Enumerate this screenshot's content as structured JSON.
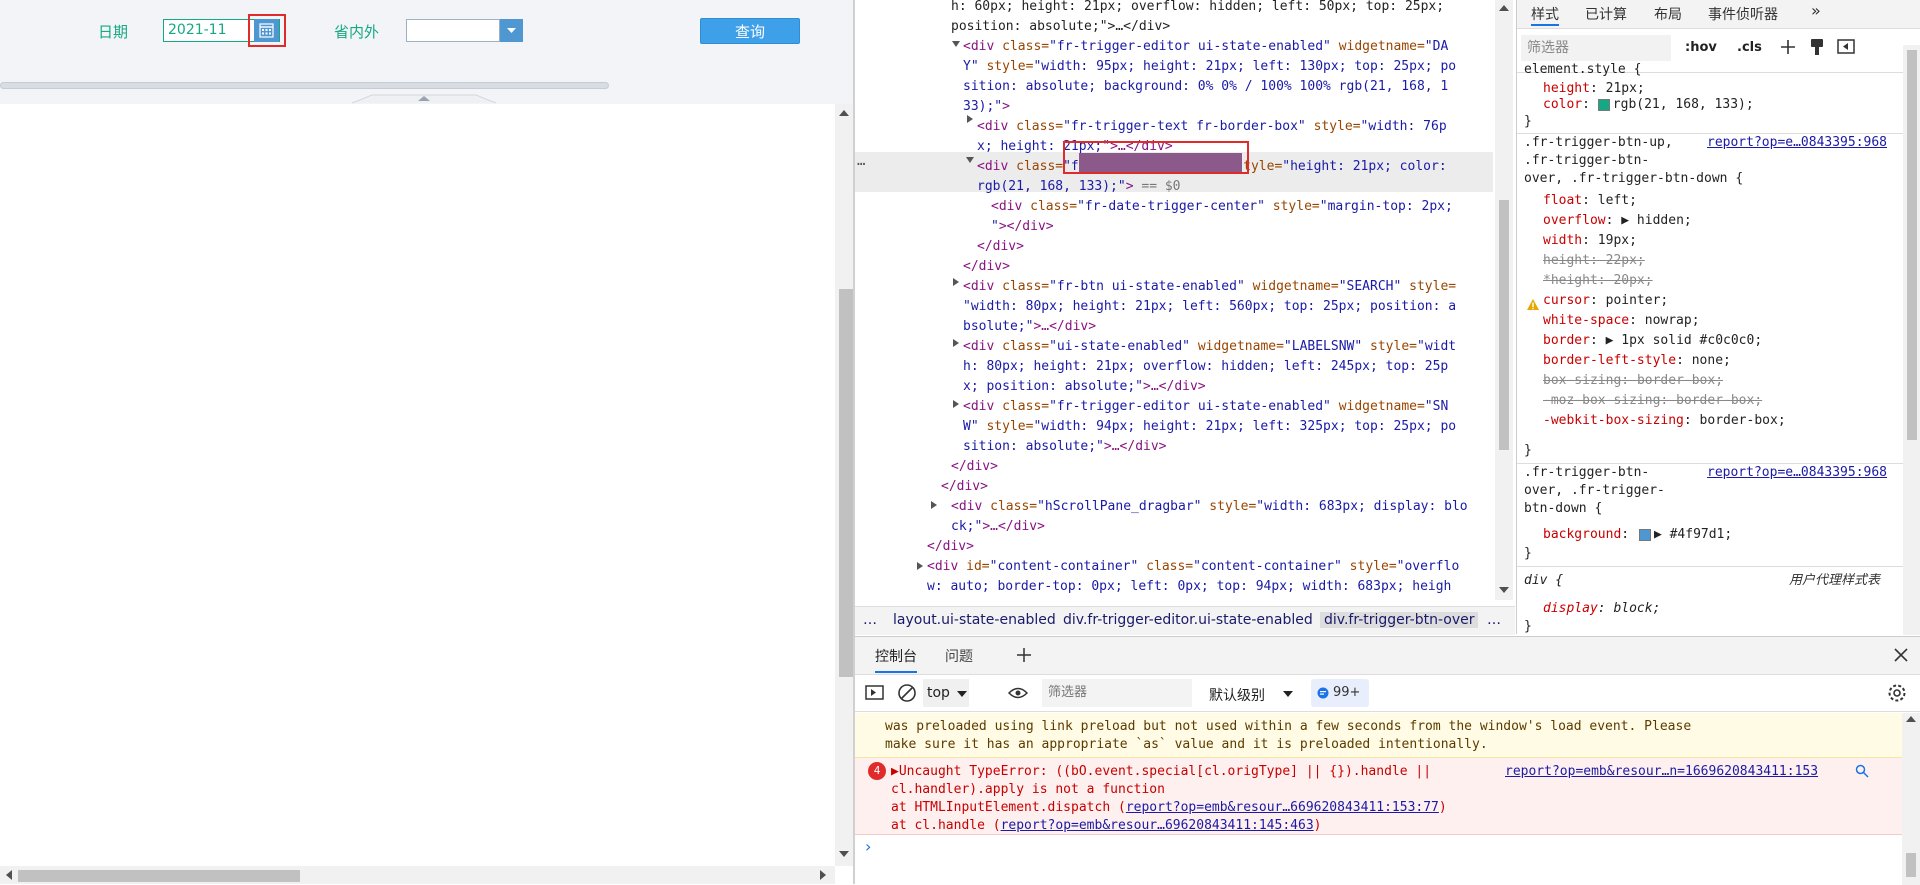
{
  "left": {
    "date_label": "日期",
    "date_value": "2021-11",
    "snw_label": "省内外",
    "snw_value": "",
    "search_label": "查询"
  },
  "elements": {
    "lines": [
      {
        "text_parts": [
          {
            "c": "txt",
            "t": "h: 60px; height: 21px; overflow: hidden; left: 50px; top: 25px;"
          }
        ]
      },
      {
        "text_parts": [
          {
            "c": "txt",
            "t": "position: absolute;\">…</div>"
          }
        ]
      },
      {
        "text_parts": [
          {
            "c": "tag",
            "t": "<div "
          },
          {
            "c": "attr",
            "t": "class="
          },
          {
            "c": "val",
            "t": "\"fr-trigger-editor ui-state-enabled\""
          },
          {
            "c": "attr",
            "t": " widgetname="
          },
          {
            "c": "val",
            "t": "\"DA"
          }
        ]
      },
      {
        "text_parts": [
          {
            "c": "val",
            "t": "Y\""
          },
          {
            "c": "attr",
            "t": " style="
          },
          {
            "c": "val",
            "t": "\"width: 95px; height: 21px; left: 130px; top: 25px; po"
          }
        ]
      },
      {
        "text_parts": [
          {
            "c": "val",
            "t": "sition: absolute; background:  0% 0% / 100% 100% rgb(21, 168, 1"
          }
        ]
      },
      {
        "text_parts": [
          {
            "c": "val",
            "t": "33);\""
          },
          {
            "c": "tag",
            "t": ">"
          }
        ]
      },
      {
        "text_parts": [
          {
            "c": "tag",
            "t": "<div "
          },
          {
            "c": "attr",
            "t": "class="
          },
          {
            "c": "val",
            "t": "\"fr-trigger-text fr-border-box\""
          },
          {
            "c": "attr",
            "t": " style="
          },
          {
            "c": "val",
            "t": "\"width: 76p"
          }
        ]
      },
      {
        "text_parts": [
          {
            "c": "val",
            "t": "x; height: 21px;\""
          },
          {
            "c": "tag",
            "t": ">…</div>"
          }
        ]
      },
      {
        "text_parts": [
          {
            "c": "tag",
            "t": "<div "
          },
          {
            "c": "attr",
            "t": "class="
          },
          {
            "c": "val",
            "t": "\"fr-trigger-btn-over\""
          },
          {
            "c": "attr",
            "t": " style="
          },
          {
            "c": "val",
            "t": "\"height: 21px; color:"
          }
        ]
      },
      {
        "text_parts": [
          {
            "c": "val",
            "t": "rgb(21, 168, 133);\""
          },
          {
            "c": "tag",
            "t": ">"
          },
          {
            "c": "cmt",
            "t": " == $0"
          }
        ]
      },
      {
        "text_parts": [
          {
            "c": "tag",
            "t": "<div "
          },
          {
            "c": "attr",
            "t": "class="
          },
          {
            "c": "val",
            "t": "\"fr-date-trigger-center\""
          },
          {
            "c": "attr",
            "t": " style="
          },
          {
            "c": "val",
            "t": "\"margin-top: 2px;"
          }
        ]
      },
      {
        "text_parts": [
          {
            "c": "val",
            "t": "\""
          },
          {
            "c": "tag",
            "t": "></div>"
          }
        ]
      },
      {
        "text_parts": [
          {
            "c": "tag",
            "t": "</div>"
          }
        ]
      },
      {
        "text_parts": [
          {
            "c": "tag",
            "t": "</div>"
          }
        ]
      },
      {
        "text_parts": [
          {
            "c": "tag",
            "t": "<div "
          },
          {
            "c": "attr",
            "t": "class="
          },
          {
            "c": "val",
            "t": "\"fr-btn ui-state-enabled\""
          },
          {
            "c": "attr",
            "t": " widgetname="
          },
          {
            "c": "val",
            "t": "\"SEARCH\""
          },
          {
            "c": "attr",
            "t": " style="
          }
        ]
      },
      {
        "text_parts": [
          {
            "c": "val",
            "t": "\"width: 80px; height: 21px; left: 560px; top: 25px; position: a"
          }
        ]
      },
      {
        "text_parts": [
          {
            "c": "val",
            "t": "bsolute;\""
          },
          {
            "c": "tag",
            "t": ">…</div>"
          }
        ]
      },
      {
        "text_parts": [
          {
            "c": "tag",
            "t": "<div "
          },
          {
            "c": "attr",
            "t": "class="
          },
          {
            "c": "val",
            "t": "\"ui-state-enabled\""
          },
          {
            "c": "attr",
            "t": " widgetname="
          },
          {
            "c": "val",
            "t": "\"LABELSNW\""
          },
          {
            "c": "attr",
            "t": " style="
          },
          {
            "c": "val",
            "t": "\"widt"
          }
        ]
      },
      {
        "text_parts": [
          {
            "c": "val",
            "t": "h: 80px; height: 21px; overflow: hidden; left: 245px; top: 25p"
          }
        ]
      },
      {
        "text_parts": [
          {
            "c": "val",
            "t": "x; position: absolute;\""
          },
          {
            "c": "tag",
            "t": ">…</div>"
          }
        ]
      },
      {
        "text_parts": [
          {
            "c": "tag",
            "t": "<div "
          },
          {
            "c": "attr",
            "t": "class="
          },
          {
            "c": "val",
            "t": "\"fr-trigger-editor ui-state-enabled\""
          },
          {
            "c": "attr",
            "t": " widgetname="
          },
          {
            "c": "val",
            "t": "\"SN"
          }
        ]
      },
      {
        "text_parts": [
          {
            "c": "val",
            "t": "W\""
          },
          {
            "c": "attr",
            "t": " style="
          },
          {
            "c": "val",
            "t": "\"width: 94px; height: 21px; left: 325px; top: 25px; po"
          }
        ]
      },
      {
        "text_parts": [
          {
            "c": "val",
            "t": "sition: absolute;\""
          },
          {
            "c": "tag",
            "t": ">…</div>"
          }
        ]
      },
      {
        "text_parts": [
          {
            "c": "tag",
            "t": "</div>"
          }
        ]
      },
      {
        "text_parts": [
          {
            "c": "tag",
            "t": "</div>"
          }
        ]
      },
      {
        "text_parts": [
          {
            "c": "tag",
            "t": "<div "
          },
          {
            "c": "attr",
            "t": "class="
          },
          {
            "c": "val",
            "t": "\"hScrollPane_dragbar\""
          },
          {
            "c": "attr",
            "t": " style="
          },
          {
            "c": "val",
            "t": "\"width: 683px; display: blo"
          }
        ]
      },
      {
        "text_parts": [
          {
            "c": "val",
            "t": "ck;\""
          },
          {
            "c": "tag",
            "t": ">…</div>"
          }
        ]
      },
      {
        "text_parts": [
          {
            "c": "tag",
            "t": "</div>"
          }
        ]
      },
      {
        "text_parts": [
          {
            "c": "tag",
            "t": "<div "
          },
          {
            "c": "attr",
            "t": "id="
          },
          {
            "c": "val",
            "t": "\"content-container\""
          },
          {
            "c": "attr",
            "t": " class="
          },
          {
            "c": "val",
            "t": "\"content-container\""
          },
          {
            "c": "attr",
            "t": " style="
          },
          {
            "c": "val",
            "t": "\"overflo"
          }
        ]
      },
      {
        "text_parts": [
          {
            "c": "val",
            "t": "w: auto; border-top: 0px; left: 0px; top: 94px; width: 683px; heigh"
          }
        ]
      }
    ],
    "more_dots": "…",
    "breadcrumbs": [
      "…",
      "layout.ui-state-enabled",
      "div.fr-trigger-editor.ui-state-enabled",
      "div.fr-trigger-btn-over",
      "…"
    ]
  },
  "styles": {
    "tabs": [
      "样式",
      "已计算",
      "布局",
      "事件侦听器",
      "»"
    ],
    "filter_placeholder": "筛选器",
    "hov": ":hov",
    "cls": ".cls",
    "element_style_selector": "element.style {",
    "element_props": [
      {
        "name": "height",
        "value": "21px;"
      },
      {
        "name": "color",
        "value": "rgb(21, 168, 133);"
      }
    ],
    "close_brace": "}",
    "rule1": {
      "selector_lines": [
        ".fr-trigger-btn-up,",
        ".fr-trigger-btn-",
        "over, .fr-trigger-btn-down {"
      ],
      "source": "report?op=e…0843395:968",
      "props": [
        {
          "name": "float",
          "value": "left;",
          "strike": false
        },
        {
          "name": "overflow",
          "value": "▶ hidden;",
          "strike": false
        },
        {
          "name": "width",
          "value": "19px;",
          "strike": false
        },
        {
          "name": "height",
          "value": "22px;",
          "strike": true
        },
        {
          "name": "*height",
          "value": "20px;",
          "strike": true
        },
        {
          "name": "cursor",
          "value": "pointer;",
          "strike": false
        },
        {
          "name": "white-space",
          "value": "nowrap;",
          "strike": false
        },
        {
          "name": "border",
          "value": "▶ 1px solid #c0c0c0;",
          "strike": false
        },
        {
          "name": "border-left-style",
          "value": "none;",
          "strike": false
        },
        {
          "name": "box-sizing",
          "value": "border-box;",
          "strike": true
        },
        {
          "name": "-moz-box-sizing",
          "value": "border-box;",
          "strike": true
        },
        {
          "name": "-webkit-box-sizing",
          "value": "border-box;",
          "strike": false
        }
      ]
    },
    "rule2": {
      "selector_lines": [
        ".fr-trigger-btn-",
        "over, .fr-trigger-",
        "btn-down {"
      ],
      "source": "report?op=e…0843395:968",
      "props": [
        {
          "name": "background",
          "value": "▶ #4f97d1;"
        }
      ]
    },
    "rule3": {
      "selector": "div {",
      "source": "用户代理样式表",
      "props": [
        {
          "name": "display",
          "value": "block;"
        }
      ]
    }
  },
  "console": {
    "tabs": [
      "控制台",
      "问题"
    ],
    "context": "top",
    "filter_placeholder": "筛选器",
    "level": "默认级别",
    "count": "99+",
    "warning_lines": [
      "was preloaded using link preload but not used within a few seconds from the window's load event. Please",
      "make sure it has an appropriate `as` value and it is preloaded intentionally."
    ],
    "error_count": "4",
    "error_lines": [
      "▶Uncaught TypeError: ((bO.event.special[cl.origType] || {}).handle ||",
      "cl.handler).apply is not a function"
    ],
    "error_source": "report?op=emb&resour…n=1669620843411:153",
    "stack": [
      {
        "prefix": "    at HTMLInputElement.dispatch (",
        "link": "report?op=emb&resour…669620843411:153:77",
        "suffix": ")"
      },
      {
        "prefix": "    at cl.handle (",
        "link": "report?op=emb&resour…69620843411:145:463",
        "suffix": ")"
      }
    ],
    "prompt": "›"
  },
  "colors": {
    "accent_green": "#15a885",
    "trigger_blue": "#4f97d1",
    "highlight_red": "#e02b2b"
  }
}
